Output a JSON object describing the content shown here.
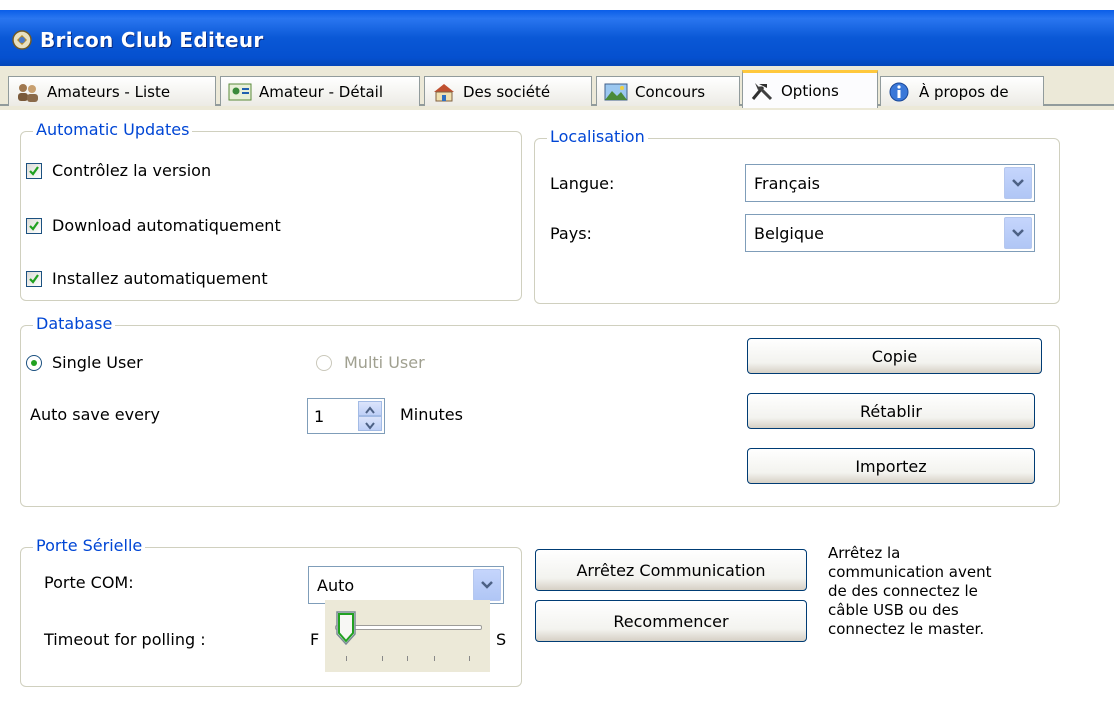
{
  "window": {
    "title": "Bricon Club Editeur"
  },
  "tabs": [
    {
      "label": "Amateurs - Liste",
      "icon": "users-icon"
    },
    {
      "label": "Amateur - Détail",
      "icon": "user-card-icon"
    },
    {
      "label": "Des société",
      "icon": "building-icon"
    },
    {
      "label": "Concours",
      "icon": "landscape-icon"
    },
    {
      "label": "Options",
      "icon": "tools-icon",
      "active": true
    },
    {
      "label": "À propos de",
      "icon": "info-icon"
    }
  ],
  "updates": {
    "legend": "Automatic Updates",
    "items": [
      {
        "label": "Contrôlez la version",
        "checked": true
      },
      {
        "label": "Download automatiquement",
        "checked": true
      },
      {
        "label": "Installez automatiquement",
        "checked": true
      }
    ]
  },
  "localisation": {
    "legend": "Localisation",
    "language_label": "Langue:",
    "language_value": "Français",
    "country_label": "Pays:",
    "country_value": "Belgique"
  },
  "database": {
    "legend": "Database",
    "single_user": "Single User",
    "multi_user": "Multi User",
    "autosave_label": "Auto save every",
    "autosave_value": "1",
    "autosave_unit": "Minutes",
    "copy_button": "Copie",
    "restore_button": "Rétablir",
    "import_button": "Importez"
  },
  "serial": {
    "legend": "Porte Sérielle",
    "port_label": "Porte COM:",
    "port_value": "Auto",
    "timeout_label": "Timeout for polling :",
    "slider_min_label": "F",
    "slider_max_label": "S",
    "slider_level": 0
  },
  "communication": {
    "stop_button": "Arrêtez Communication",
    "restart_button": "Recommencer",
    "note_lines": [
      "Arrêtez la",
      "communication avent",
      "de des connectez le",
      "câble USB ou des",
      "connectez le master."
    ]
  },
  "colors": {
    "legend_blue": "#0046d5",
    "titlebar_blue": "#0a58d6",
    "tab_highlight": "#ffc83c",
    "check_green": "#21a121"
  }
}
